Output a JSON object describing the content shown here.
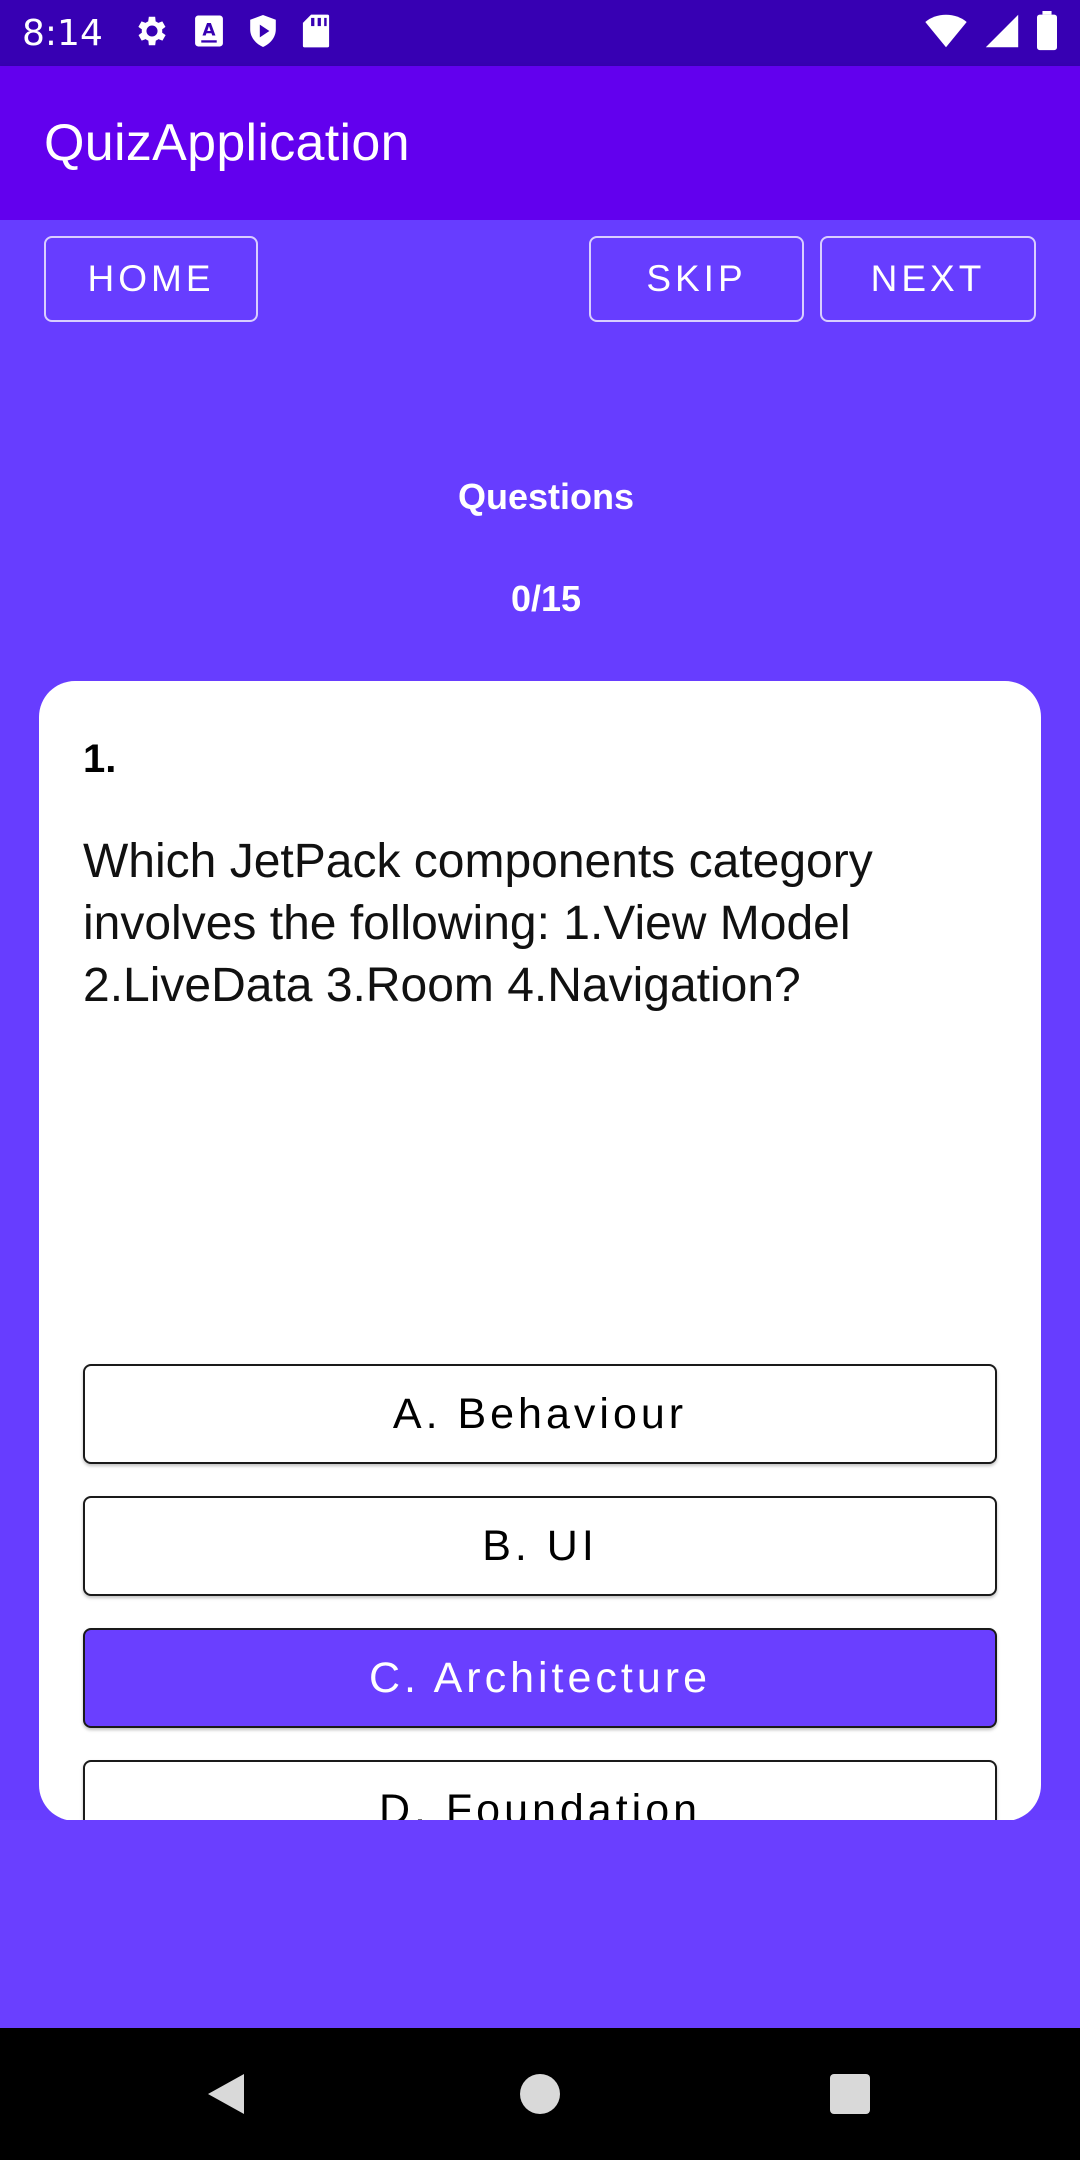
{
  "status_bar": {
    "time": "8:14",
    "left_icons": [
      "gear-icon",
      "accessibility-a-icon",
      "shield-play-icon",
      "sd-card-icon"
    ],
    "right_icons": [
      "wifi-icon",
      "cell-signal-icon",
      "battery-icon"
    ]
  },
  "app_bar": {
    "title": "QuizApplication"
  },
  "toolbar": {
    "home_label": "HOME",
    "skip_label": "SKIP",
    "next_label": "NEXT"
  },
  "progress": {
    "label": "Questions",
    "count": "0/15"
  },
  "question": {
    "number": "1.",
    "text": "Which JetPack components category involves the following: 1.View Model 2.LiveData 3.Room 4.Navigation?",
    "options": [
      {
        "label": "A. Behaviour",
        "selected": false
      },
      {
        "label": "B. UI",
        "selected": false
      },
      {
        "label": "C. Architecture",
        "selected": true
      },
      {
        "label": "D. Foundation",
        "selected": false
      }
    ]
  },
  "colors": {
    "status_bar": "#3700B3",
    "app_bar": "#6200EE",
    "background": "#673DFF",
    "selected_option": "#6A3FFF",
    "card": "#FFFFFF"
  },
  "nav_bar": {
    "icons": [
      "back-triangle-icon",
      "home-circle-icon",
      "recents-square-icon"
    ]
  }
}
